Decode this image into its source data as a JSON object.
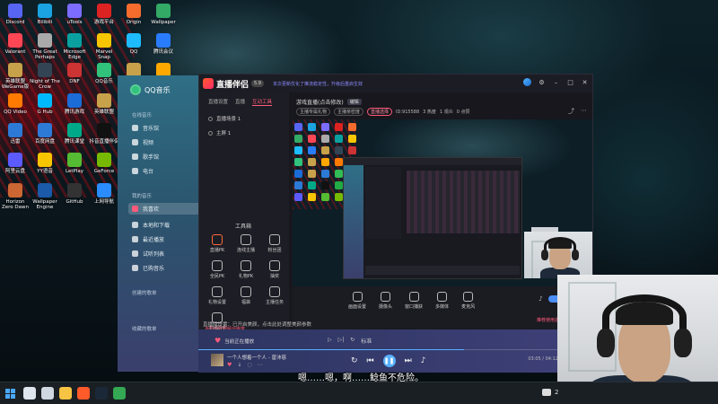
{
  "desktop": {
    "icons": [
      {
        "label": "Discord",
        "color": "#5865f2"
      },
      {
        "label": "Bilibili",
        "color": "#1aa3e0"
      },
      {
        "label": "uTools",
        "color": "#7c6cff"
      },
      {
        "label": "游戏平台",
        "color": "#d22"
      },
      {
        "label": "Origin",
        "color": "#f56c2d"
      },
      {
        "label": "Wallpaper",
        "color": "#3a6"
      },
      {
        "label": "Valorant",
        "color": "#ff4655"
      },
      {
        "label": "The Great Perhaps",
        "color": "#aaa"
      },
      {
        "label": "Microsoft Edge",
        "color": "#0ba0a0"
      },
      {
        "label": "Marvel Snap",
        "color": "#f7c600"
      },
      {
        "label": "QQ",
        "color": "#1ebcff"
      },
      {
        "label": "腾讯会议",
        "color": "#2a7cff"
      },
      {
        "label": "英雄联盟 WeGame版",
        "color": "#c8a24a"
      },
      {
        "label": "Night of The Crow",
        "color": "#345"
      },
      {
        "label": "DNF",
        "color": "#c33"
      },
      {
        "label": "QQ音乐",
        "color": "#31c27c"
      },
      {
        "label": "英雄联盟 WeGame版",
        "color": "#c8a24a"
      },
      {
        "label": "虎牙直播",
        "color": "#ffa800"
      },
      {
        "label": "QQ Video",
        "color": "#ff7a00"
      },
      {
        "label": "G Hub",
        "color": "#00b8fc"
      },
      {
        "label": "腾讯游戏",
        "color": "#1b6cd6"
      },
      {
        "label": "英雄联盟",
        "color": "#c8a24a"
      },
      {
        "label": "PlayStation",
        "color": "#2d7ad6"
      },
      {
        "label": "Dance of Fire",
        "color": "#3b5"
      },
      {
        "label": "迅雷",
        "color": "#2d7ad6"
      },
      {
        "label": "百度网盘",
        "color": "#2d7ad6"
      },
      {
        "label": "腾讯课堂",
        "color": "#0a8"
      },
      {
        "label": "抖音直播伴侣",
        "color": "#111"
      },
      {
        "label": "Fluentables",
        "color": "#2a4"
      },
      {
        "label": "微信",
        "color": "#1aad19"
      },
      {
        "label": "阿里云盘",
        "color": "#5b5bff"
      },
      {
        "label": "YY语音",
        "color": "#f7c600"
      },
      {
        "label": "LetPlay",
        "color": "#5b3"
      },
      {
        "label": "GeForce",
        "color": "#76b900"
      },
      {
        "label": "英雄联盟",
        "color": "#c8a24a"
      },
      {
        "label": "Wizard of Legend",
        "color": "#a33"
      },
      {
        "label": "Horizon Zero Dawn",
        "color": "#c63"
      },
      {
        "label": "Wallpaper Engine",
        "color": "#1a5aa8"
      },
      {
        "label": "GitHub",
        "color": "#333"
      },
      {
        "label": "上网导航",
        "color": "#2a8cff"
      },
      {
        "label": "WeFLAY",
        "color": "#5b3"
      },
      {
        "label": "Gogo_ma",
        "color": "#777"
      }
    ]
  },
  "qqmusic": {
    "brand": "QQ音乐",
    "sections": {
      "online": "在线音乐",
      "mine": "我的音乐",
      "created": "创建的歌单",
      "collected": "收藏的歌单"
    },
    "items": [
      {
        "label": "音乐馆",
        "icon": "music-hall-icon"
      },
      {
        "label": "视频",
        "icon": "video-icon"
      },
      {
        "label": "歌手馆",
        "icon": "singer-icon"
      },
      {
        "label": "电台",
        "icon": "radio-icon"
      }
    ],
    "my_items": [
      {
        "label": "我喜欢",
        "icon": "heart-icon"
      },
      {
        "label": "本地和下载",
        "icon": "download-icon"
      },
      {
        "label": "最近播放",
        "icon": "recent-icon"
      },
      {
        "label": "试听列表",
        "icon": "list-icon"
      },
      {
        "label": "已购音乐",
        "icon": "purchased-icon"
      }
    ]
  },
  "stream_tool": {
    "app_name": "直播伴侣",
    "version": "5.9",
    "notice": "本次更新优化了推流稳定性，升级后重启生效",
    "window_controls": [
      "settings",
      "minimize",
      "maximize",
      "close"
    ],
    "left_tabs": [
      "直播设置",
      "直播",
      "互动工具"
    ],
    "active_tab": 2,
    "scenes": [
      "直播场景 1",
      "主屏 1"
    ],
    "tools_heading": "工具箱",
    "tools": [
      {
        "label": "直播PK",
        "hot": true
      },
      {
        "label": "连线主播"
      },
      {
        "label": "粉丝团"
      },
      {
        "label": "全民PK"
      },
      {
        "label": "礼物PK"
      },
      {
        "label": "抽奖"
      },
      {
        "label": "礼物设置"
      },
      {
        "label": "福袋"
      },
      {
        "label": "主播任务"
      },
      {
        "label": "主播助手"
      }
    ],
    "left_footer": "当前设置视频分辨率",
    "preview_title": "游戏直播(点击修改)",
    "preview_tag": "编辑",
    "preview_id": "ID:915588",
    "preview_chips": [
      "主播专属礼物",
      "主播亲密度"
    ],
    "preview_chip_active": "直播选择",
    "preview_stats": [
      "3 热度",
      "1 观众",
      "0 点赞"
    ],
    "bottom_tools": [
      "画面设置",
      "摄像头",
      "窗口捕获",
      "多媒体",
      "麦克风"
    ],
    "bottom_warning": "推荐使用游戏捕获",
    "bottom_notice": "直播间设置：已开启美颜，点击此处调整美颜参数",
    "mic_level": 0.4
  },
  "player": {
    "favorite_label": "当前正在播放",
    "track": "一个人想着一个人",
    "artist": "曾沛慈",
    "time": "03:05 / 04:12",
    "quality": "标准",
    "progress": 0.73
  },
  "subtitle": "嗯……嗯，啊……鲶鱼不危险。",
  "taskbar": {
    "apps": [
      {
        "name": "search",
        "color": "#dfe6ee"
      },
      {
        "name": "task-view",
        "color": "#cfd8e0"
      },
      {
        "name": "file-explorer",
        "color": "#f6c343"
      },
      {
        "name": "stream-tool",
        "color": "#ff5a2a"
      },
      {
        "name": "steam",
        "color": "#1b2838"
      },
      {
        "name": "chrome",
        "color": "#34a853"
      }
    ],
    "tray_text": "2"
  }
}
